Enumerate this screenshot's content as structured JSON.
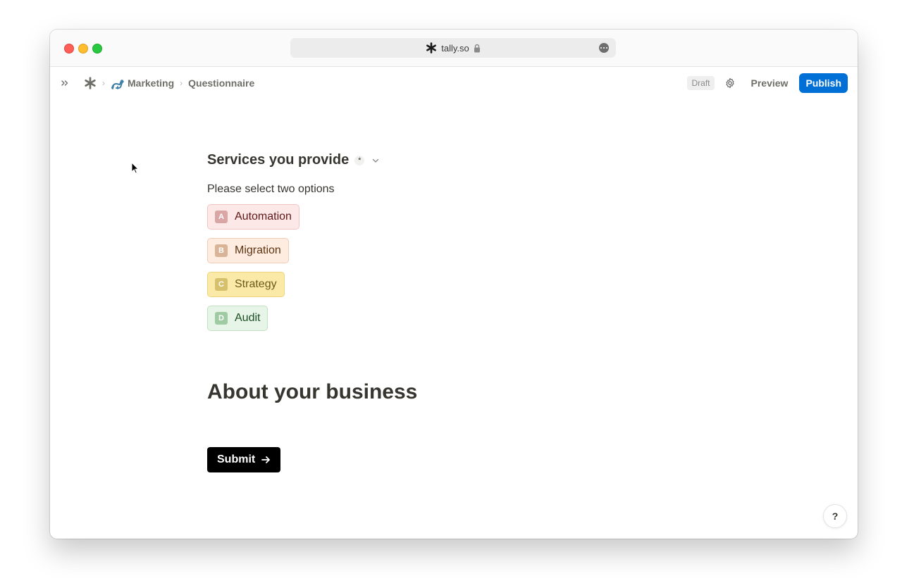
{
  "browser": {
    "url": "tally.so"
  },
  "toolbar": {
    "breadcrumbs": [
      {
        "icon": "dinosaur-emoji",
        "label": "Marketing"
      },
      {
        "label": "Questionnaire"
      }
    ],
    "status": "Draft",
    "preview_label": "Preview",
    "publish_label": "Publish"
  },
  "form": {
    "question": {
      "title": "Services you provide",
      "required_mark": "*",
      "description": "Please select two options",
      "options": [
        {
          "key": "A",
          "label": "Automation",
          "color": "#fde8e8"
        },
        {
          "key": "B",
          "label": "Migration",
          "color": "#fdecdf"
        },
        {
          "key": "C",
          "label": "Strategy",
          "color": "#fbeaa7"
        },
        {
          "key": "D",
          "label": "Audit",
          "color": "#e6f5e7"
        }
      ]
    },
    "section_heading": "About your business",
    "submit_label": "Submit"
  },
  "help_label": "?",
  "colors": {
    "publish": "#0070d7",
    "submit": "#000000"
  }
}
